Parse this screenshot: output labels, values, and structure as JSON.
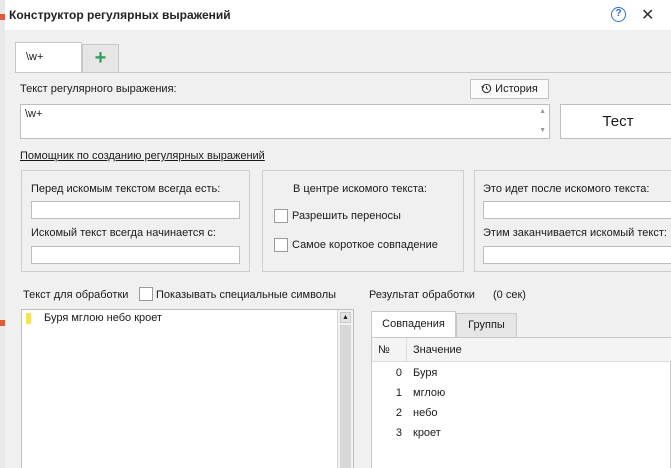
{
  "window": {
    "title": "Конструктор регулярных выражений",
    "help_icon_glyph": "?",
    "close_glyph": "✕"
  },
  "tabs": [
    {
      "label": "\\w+"
    },
    {
      "label": "+"
    }
  ],
  "regex": {
    "label": "Текст регулярного выражения:",
    "value": "\\w+",
    "history_button": "История",
    "test_button": "Тест"
  },
  "helper": {
    "link": "Помощник по созданию регулярных выражений",
    "before_label": "Перед искомым текстом всегда есть:",
    "starts_with_label": "Искомый текст всегда начинается с:",
    "center_label": "В центре искомого текста:",
    "allow_wrap_label": "Разрешить переносы",
    "shortest_match_label": "Самое короткое совпадение",
    "after_label": "Это идет после искомого текста:",
    "ends_with_label": "Этим заканчивается искомый текст:"
  },
  "input_text": {
    "label": "Текст для обработки",
    "show_special_label": "Показывать специальные символы",
    "content": "Буря мглою небо кроет"
  },
  "result": {
    "label": "Результат обработки",
    "time": "(0 сек)",
    "tabs": [
      {
        "label": "Совпадения"
      },
      {
        "label": "Группы"
      }
    ],
    "columns": {
      "num": "№",
      "value": "Значение"
    },
    "rows": [
      {
        "num": "0",
        "value": "Буря"
      },
      {
        "num": "1",
        "value": "мглою"
      },
      {
        "num": "2",
        "value": "небо"
      },
      {
        "num": "3",
        "value": "кроет"
      }
    ]
  },
  "colors": {
    "accent_green": "#2aa05a",
    "help_blue": "#2d6fd1",
    "cursor_yellow": "#f3e35a",
    "left_marker": "#e05a3a"
  }
}
